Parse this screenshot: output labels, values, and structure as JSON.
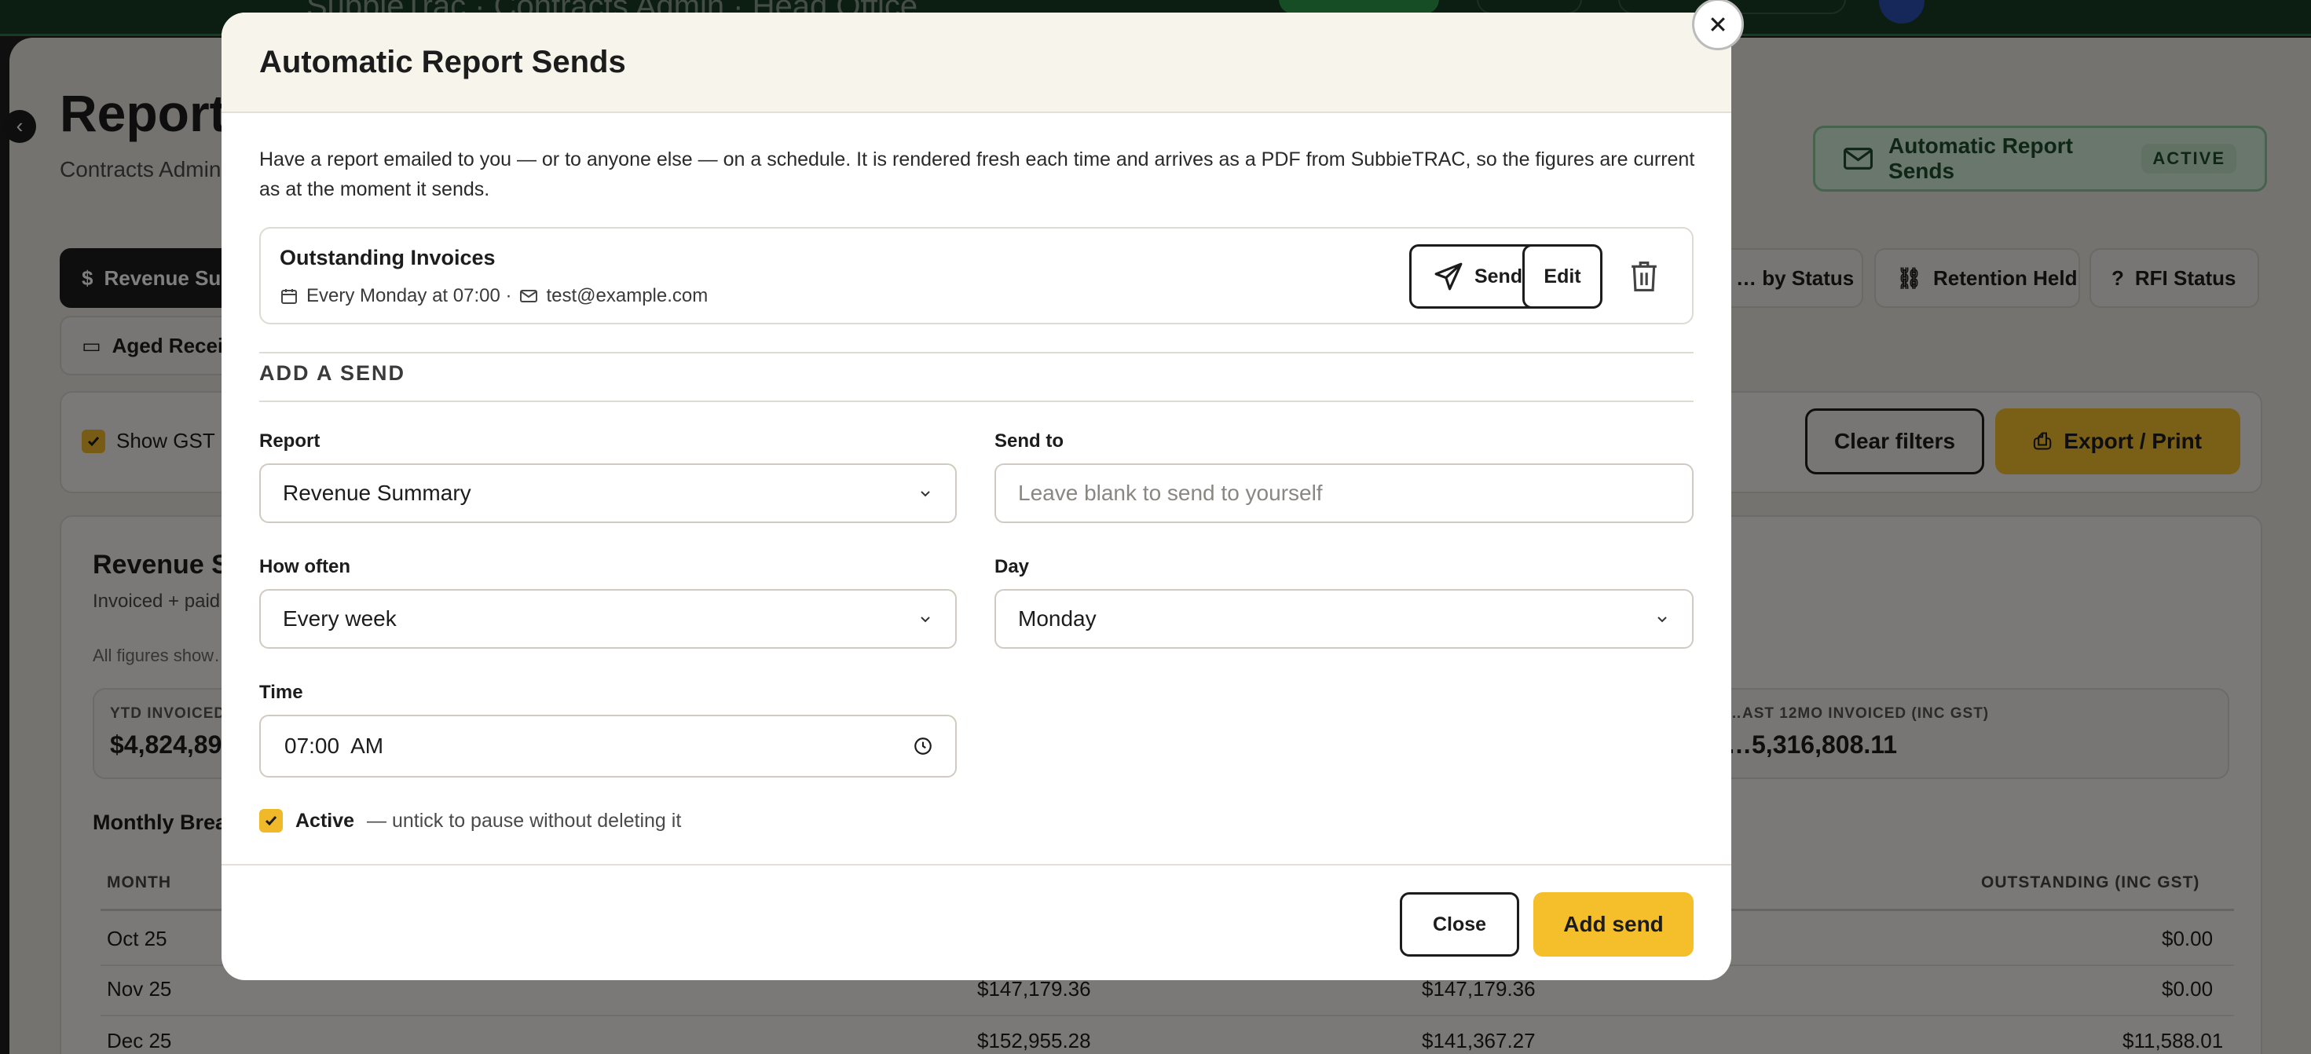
{
  "background": {
    "app_title": "SubbieTrac · Contracts Admin · Head Office",
    "page_title": "Reports",
    "page_subtitle": "Contracts Admin … below, filter it in p…",
    "tabs_row1": [
      "Revenue Su…",
      "… by Status",
      "Retention Held",
      "RFI Status"
    ],
    "tabs_row2": [
      "Aged Recei…"
    ],
    "auto_chip": {
      "label": "Automatic Report Sends",
      "badge": "ACTIVE"
    },
    "show_gst_label": "Show GST",
    "clear_filters_label": "Clear filters",
    "export_label": "Export / Print",
    "report_heading": "Revenue S…",
    "report_sub": "Invoiced + paid…",
    "figures_note": "All figures show…",
    "kpis": [
      {
        "label": "YTD INVOICED",
        "value": "$4,824,89…"
      },
      {
        "label": "…AST 12MO INVOICED (INC GST)",
        "value": "…5,316,808.11"
      }
    ],
    "monthly_heading": "Monthly Brea…",
    "table": {
      "headers": [
        "MONTH",
        "OUTSTANDING (INC GST)"
      ],
      "rows": [
        {
          "month": "Oct 25",
          "c2": "",
          "c3": "",
          "outstanding": "$0.00"
        },
        {
          "month": "Nov 25",
          "c2": "$147,179.36",
          "c3": "$147,179.36",
          "outstanding": "$0.00"
        },
        {
          "month": "Dec 25",
          "c2": "$152,955.28",
          "c3": "$141,367.27",
          "outstanding": "$11,588.01"
        }
      ]
    }
  },
  "modal": {
    "title": "Automatic Report Sends",
    "intro": "Have a report emailed to you — or to anyone else — on a schedule. It is rendered fresh each time and arrives as a PDF from SubbieTRAC, so the figures are current as at the moment it sends.",
    "existing": {
      "name": "Outstanding Invoices",
      "schedule": "Every Monday at 07:00 ·",
      "email": "test@example.com",
      "send_now_label": "Send now",
      "edit_label": "Edit"
    },
    "add_section_label": "ADD A SEND",
    "form": {
      "report_label": "Report",
      "report_value": "Revenue Summary",
      "send_to_label": "Send to",
      "send_to_placeholder": "Leave blank to send to yourself",
      "how_often_label": "How often",
      "how_often_value": "Every week",
      "day_label": "Day",
      "day_value": "Monday",
      "time_label": "Time",
      "time_value": "07:00  AM",
      "active_label": "Active",
      "active_hint": "— untick to pause without deleting it",
      "active_checked": true
    },
    "close_label": "Close",
    "add_send_label": "Add send"
  },
  "colors": {
    "accent": "#f5bf2c",
    "dark": "#1c1c1c",
    "active_green": "#d3eed8"
  }
}
